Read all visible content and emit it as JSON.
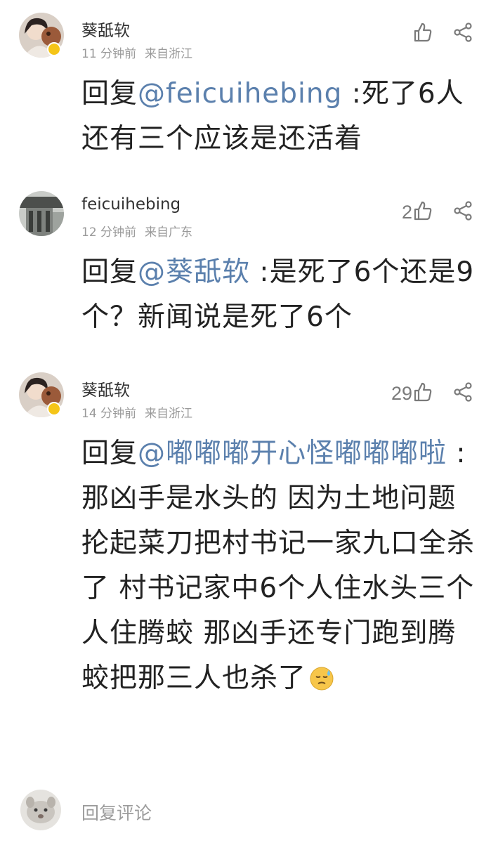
{
  "comments": [
    {
      "username": "葵舐软",
      "time": "11 分钟前",
      "location": "来自浙江",
      "likes": "",
      "reply_prefix": "回复",
      "mention": "@feicuihebing",
      "text": " :死了6人 还有三个应该是还活着"
    },
    {
      "username": "feicuihebing",
      "time": "12 分钟前",
      "location": "来自广东",
      "likes": "2",
      "reply_prefix": "回复",
      "mention": "@葵舐软",
      "text": " :是死了6个还是9个？新闻说是死了6个"
    },
    {
      "username": "葵舐软",
      "time": "14 分钟前",
      "location": "来自浙江",
      "likes": "29",
      "reply_prefix": "回复",
      "mention": "@嘟嘟嘟开心怪嘟嘟嘟啦",
      "text": " :那凶手是水头的 因为土地问题 抡起菜刀把村书记一家九口全杀了 村书记家中6个人住水头三个人住腾蛟 那凶手还专门跑到腾蛟把那三人也杀了",
      "emoji": "sweat-emoji"
    }
  ],
  "reply_bar": {
    "placeholder": "回复评论"
  },
  "icons": {
    "like": "thumbs-up-icon",
    "share": "share-icon"
  },
  "colors": {
    "mention": "#5b80ad",
    "meta": "#9a9a9a",
    "badge": "#f5c518"
  }
}
